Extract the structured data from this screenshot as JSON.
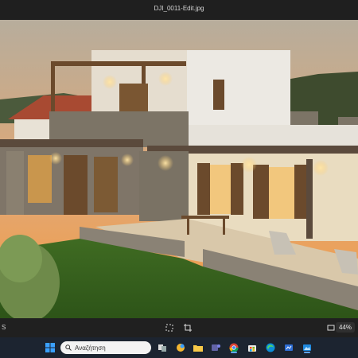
{
  "window": {
    "title": "DJI_0011-Edit.jpg"
  },
  "photo": {
    "description_icon": "photo-of-villa-at-dusk"
  },
  "viewbar": {
    "left_text": "S",
    "zoom_label": "44%",
    "icons": [
      "fit-icon",
      "crop-icon",
      "fullscreen-icon"
    ]
  },
  "taskbar": {
    "search_placeholder": "Αναζήτηση",
    "apps": [
      {
        "name": "start-icon"
      },
      {
        "name": "task-view-icon"
      },
      {
        "name": "widgets-icon"
      },
      {
        "name": "file-explorer-icon"
      },
      {
        "name": "teams-icon"
      },
      {
        "name": "chrome-icon"
      },
      {
        "name": "store-icon"
      },
      {
        "name": "edge-icon"
      },
      {
        "name": "app-icon"
      },
      {
        "name": "photos-icon"
      }
    ]
  },
  "colors": {
    "accent": "#60a5ff",
    "sky_top": "#b8aa95",
    "sky_bottom": "#f0a050"
  }
}
